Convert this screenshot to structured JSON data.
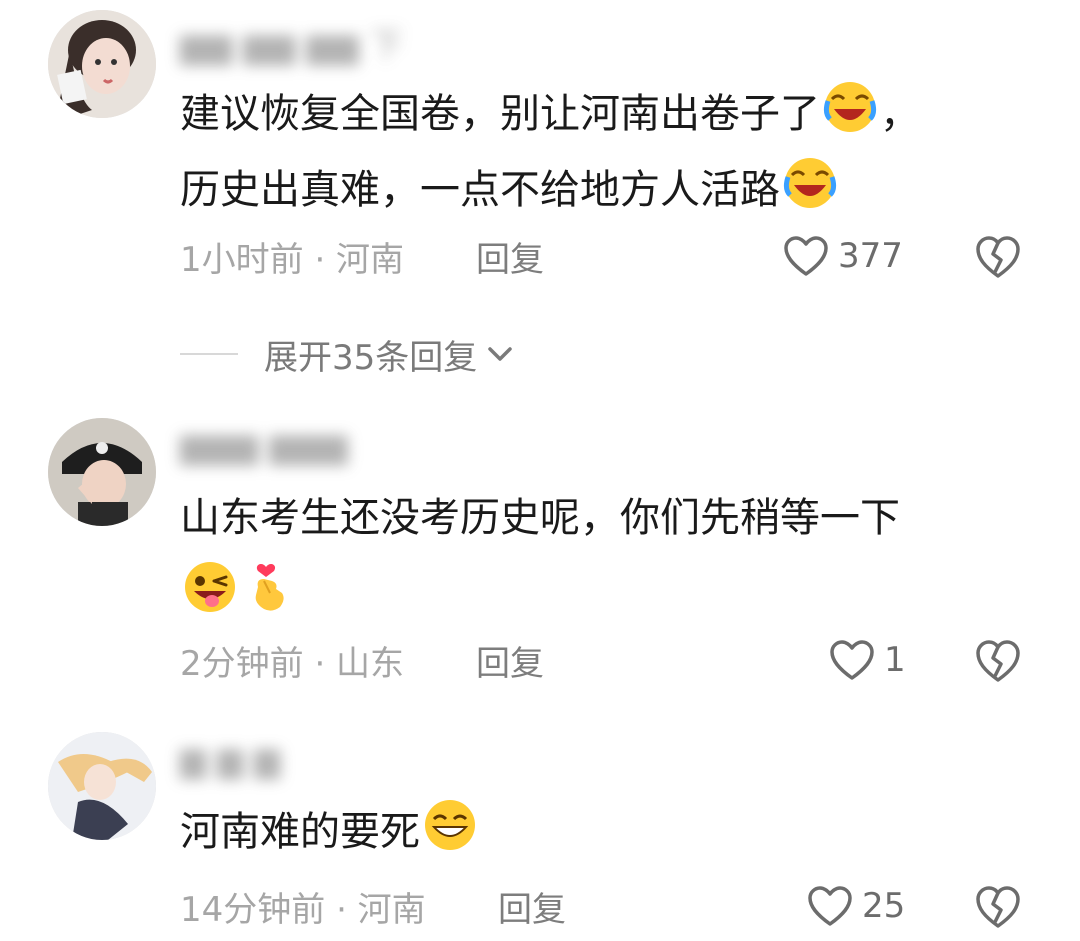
{
  "comments": [
    {
      "username": "▆▆ ▆▆ ▆▆ 下",
      "text_lines": [
        "建议恢复全国卷，别让河南出卷子了",
        "，",
        "历史出真难，一点不给地方人活路"
      ],
      "time_location": "1小时前 · 河南",
      "reply_label": "回复",
      "likes": "377",
      "expand_label": "展开35条回复"
    },
    {
      "username": "▆▆▆  ▆▆▆",
      "text_line1": "山东考生还没考历史呢，你们先稍等一下",
      "time_location": "2分钟前 · 山东",
      "reply_label": "回复",
      "likes": "1"
    },
    {
      "username": "▆ ▆ ▆",
      "text_line1": "河南难的要死",
      "time_location": "14分钟前 · 河南",
      "reply_label": "回复",
      "likes": "25"
    }
  ],
  "icons": {
    "like": "heart-outline-icon",
    "dislike": "broken-heart-icon",
    "expand": "chevron-down-icon",
    "emoji_laugh_cry": "laughing-crying-emoji",
    "emoji_wink": "winking-tongue-emoji",
    "emoji_finger_heart": "finger-heart-emoji",
    "emoji_grin": "grinning-emoji"
  },
  "colors": {
    "text": "#1a1a1a",
    "meta": "#a6a6a6",
    "icon": "#6c6c6c"
  }
}
